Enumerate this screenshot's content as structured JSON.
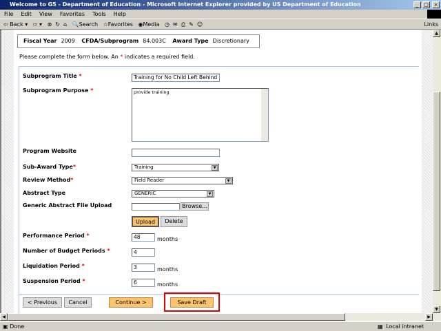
{
  "window": {
    "title": "Welcome to G5 - Department of Education - Microsoft Internet Explorer provided by US Department of Education"
  },
  "menu": [
    "File",
    "Edit",
    "View",
    "Favorites",
    "Tools",
    "Help"
  ],
  "toolbar": {
    "back": "Back",
    "search": "Search",
    "favorites": "Favorites",
    "media": "Media",
    "links": "Links"
  },
  "info": {
    "fiscal_year_label": "Fiscal Year",
    "fiscal_year": "2009",
    "cfda_label": "CFDA/Subprogram",
    "cfda": "84.003C",
    "award_type_label": "Award Type",
    "award_type": "Discretionary"
  },
  "instructions": {
    "before": "Please complete the form below. An ",
    "star": "*",
    "after": " indicates a required field."
  },
  "form": {
    "title_label": "Subprogram Title",
    "title_value": "Training for No Child Left Behind",
    "purpose_label": "Subprogram Purpose",
    "purpose_value": "provide training",
    "website_label": "Program Website",
    "website_value": "",
    "subaward_label": "Sub-Award Type",
    "subaward_value": "Training",
    "review_label": "Review Method",
    "review_value": "Field Reader",
    "abstract_label": "Abstract Type",
    "abstract_value": "GENERIC",
    "upload_label": "Generic Abstract File Upload",
    "browse": "Browse...",
    "upload": "Upload",
    "delete": "Delete",
    "performance_label": "Performance Period",
    "performance_value": "48",
    "budget_label": "Number of Budget Periods",
    "budget_value": "4",
    "liquidation_label": "Liquidation Period",
    "liquidation_value": "3",
    "suspension_label": "Suspension Period",
    "suspension_value": "6",
    "months": "months",
    "req": "*"
  },
  "buttons": {
    "previous": "< Previous",
    "cancel": "Cancel",
    "continue": "Continue >",
    "save_draft": "Save Draft"
  },
  "status": {
    "text": "Done",
    "zone": "Local intranet"
  },
  "colors": {
    "highlight": "#e00000",
    "orange_button": "#fbc36e"
  }
}
